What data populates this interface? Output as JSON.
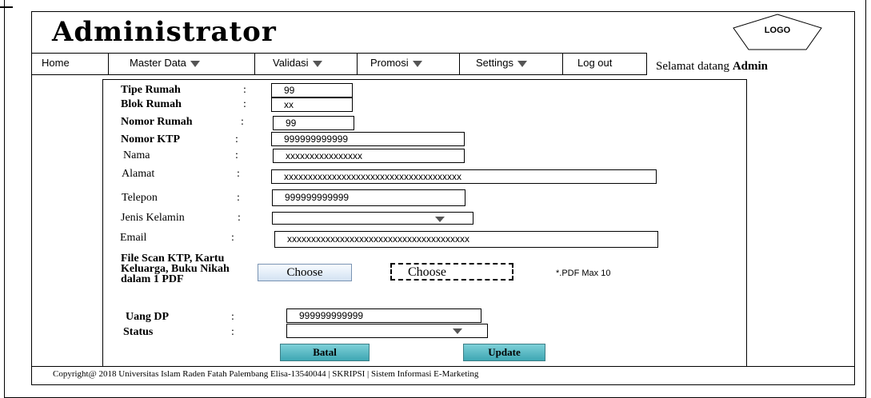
{
  "header": {
    "title": "Administrator",
    "logo_label": "LOGO",
    "welcome_prefix": "Selamat datang ",
    "welcome_user": "Admin"
  },
  "nav": {
    "items": [
      {
        "label": "Home"
      },
      {
        "label": "Master Data"
      },
      {
        "label": "Validasi"
      },
      {
        "label": "Promosi"
      },
      {
        "label": "Settings"
      },
      {
        "label": "Log out"
      }
    ]
  },
  "form": {
    "fields": [
      {
        "label": "Tipe Rumah",
        "value": "99"
      },
      {
        "label": "Blok Rumah",
        "value": "xx"
      },
      {
        "label": "Nomor Rumah",
        "value": "99"
      },
      {
        "label": "Nomor KTP",
        "value": "999999999999"
      },
      {
        "label": "Nama",
        "value": "xxxxxxxxxxxxxxxx"
      },
      {
        "label": "Alamat",
        "value": "xxxxxxxxxxxxxxxxxxxxxxxxxxxxxxxxxxxxx"
      },
      {
        "label": "Telepon",
        "value": "999999999999"
      },
      {
        "label": "Jenis Kelamin",
        "value": ""
      },
      {
        "label": "Email",
        "value": "xxxxxxxxxxxxxxxxxxxxxxxxxxxxxxxxxxxxxx"
      },
      {
        "label": "Uang DP",
        "value": "999999999999"
      },
      {
        "label": "Status",
        "value": ""
      }
    ],
    "colon": ":",
    "file_scan_label": "File Scan KTP, Kartu Keluarga, Buku Nikah dalam 1 PDF",
    "choose_button_label": "Choose",
    "choose_file_label": "Choose",
    "file_note": "*.PDF Max 10",
    "cancel_label": "Batal",
    "update_label": "Update"
  },
  "footer": {
    "text": "Copyright@ 2018 Universitas Islam Raden  Fatah Palembang    Elisa-13540044 | SKRIPSI | Sistem Informasi E-Marketing"
  }
}
